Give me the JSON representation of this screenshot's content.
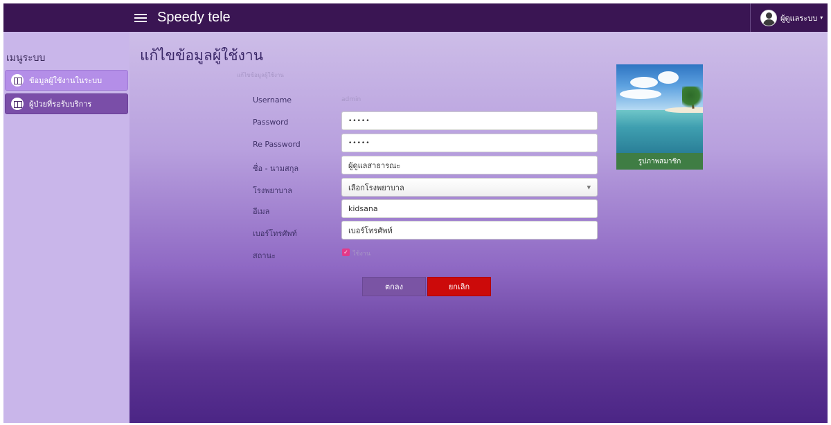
{
  "navbar": {
    "brand": "Speedy tele",
    "user_name": "ผู้ดูแลระบบ",
    "user_caret": "▾"
  },
  "sidebar": {
    "title": "เมนูระบบ",
    "items": [
      {
        "label": "ข้อมูลผู้ใช้งานในระบบ",
        "icon": "columns-icon"
      },
      {
        "label": "ผู้ป่วยที่รอรับบริการ",
        "icon": "columns-icon"
      }
    ]
  },
  "main": {
    "page_title": "แก้ไขข้อมูลผู้ใช้งาน",
    "section_label": "แก้ไขข้อมูลผู้ใช้งาน",
    "form": {
      "username_label": "Username",
      "username_value": "admin",
      "password_label": "Password",
      "password_value": "•••••",
      "repassword_label": "Re Password",
      "repassword_value": "•••••",
      "fullname_label": "ชื่อ - นามสกุล",
      "fullname_value": "ผู้ดูแลสาธารณะ",
      "hospital_label": "โรงพยาบาล",
      "hospital_value": "เลือกโรงพยาบาล",
      "email_label": "อีเมล",
      "email_value": "kidsana",
      "phone_label": "เบอร์โทรศัพท์",
      "phone_value": "เบอร์โทรศัพท์",
      "status_label": "สถานะ",
      "status_checkbox_label": "ใช้งาน"
    },
    "buttons": {
      "ok": "ตกลง",
      "cancel": "ยกเลิก"
    },
    "photo_caption": "รูปภาพสมาชิก"
  },
  "colors": {
    "navbar": "#3a1553",
    "sidebar": "#c9b6ea",
    "cancel": "#cc0a0a",
    "photo_caption_bg": "#3f7d44"
  }
}
